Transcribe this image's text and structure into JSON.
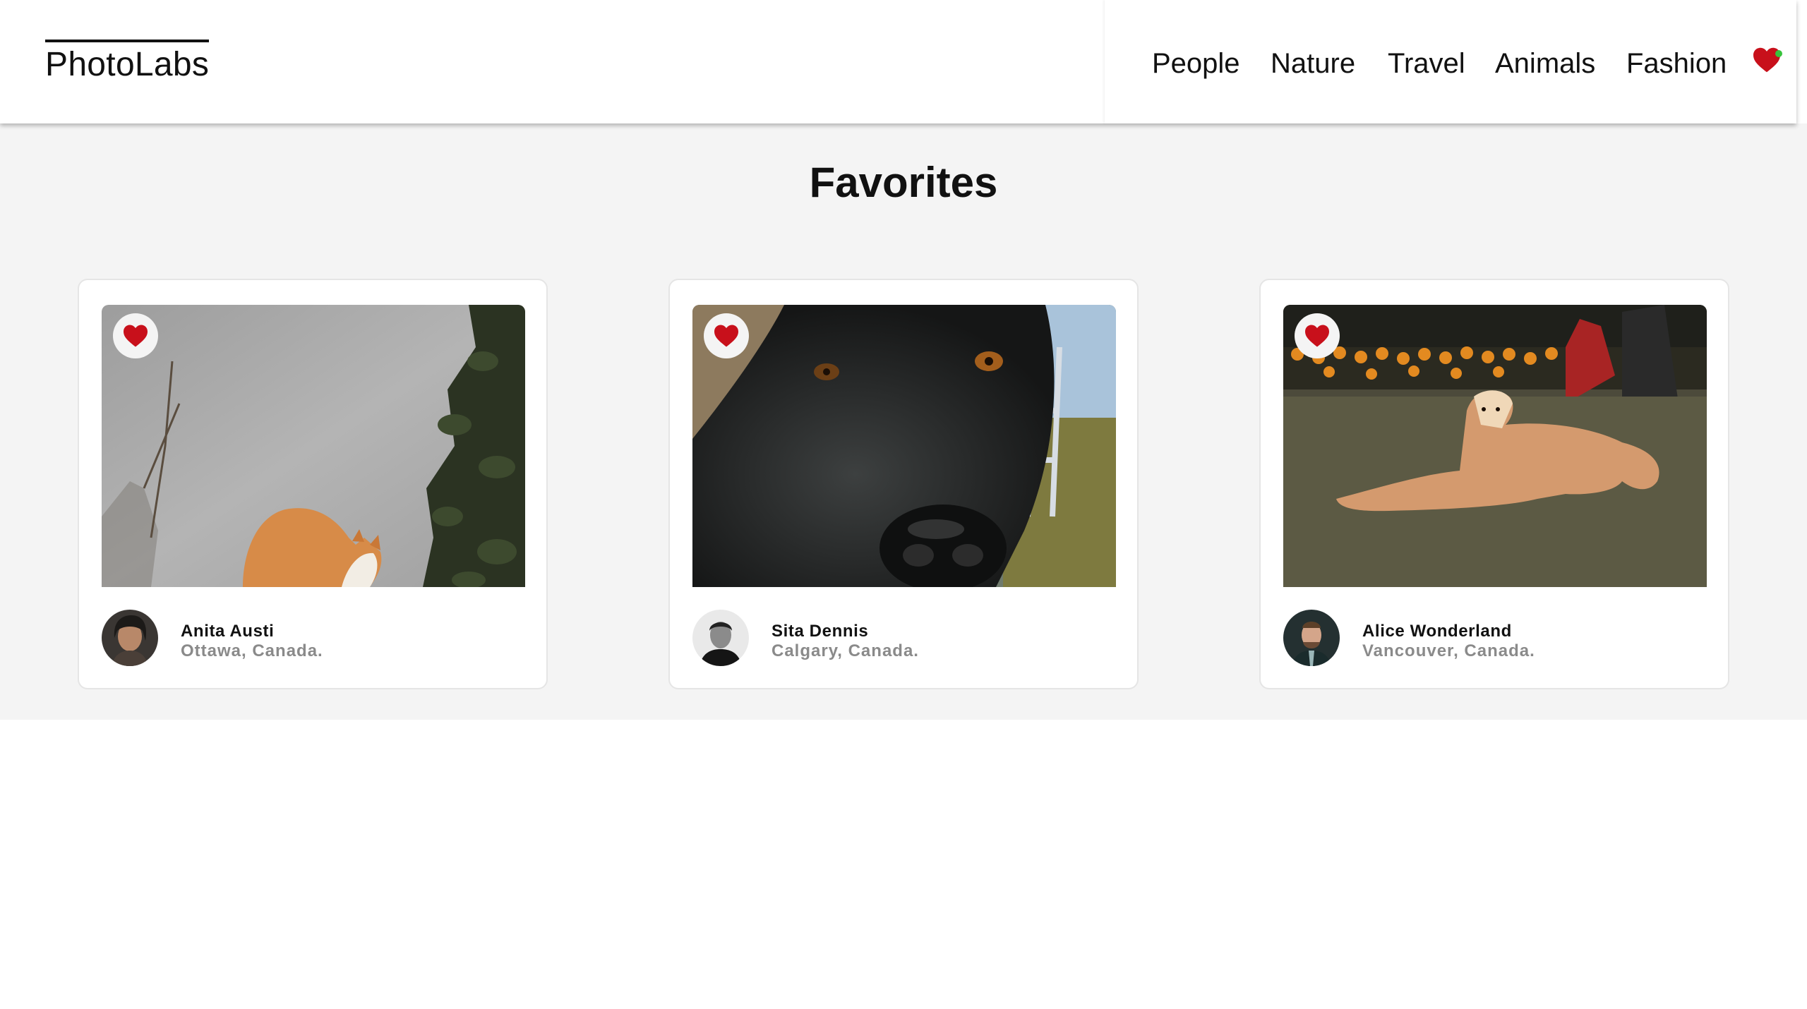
{
  "header": {
    "logo": "PhotoLabs",
    "topics": [
      {
        "label": "People"
      },
      {
        "label": "Nature"
      },
      {
        "label": "Travel"
      },
      {
        "label": "Animals"
      },
      {
        "label": "Fashion"
      }
    ],
    "favorites_icon": "heart-icon",
    "has_favorites_indicator": true
  },
  "page": {
    "title": "Favorites"
  },
  "photos": [
    {
      "user_name": "Anita Austi",
      "location": "Ottawa, Canada.",
      "favorited": true,
      "subject": "orange and white cat beside a grey wall with ivy"
    },
    {
      "user_name": "Sita Dennis",
      "location": "Calgary, Canada.",
      "favorited": true,
      "subject": "close-up of a black dog's nose"
    },
    {
      "user_name": "Alice Wonderland",
      "location": "Vancouver, Canada.",
      "favorited": true,
      "subject": "tan dog lying on grass near orange flowers"
    }
  ],
  "colors": {
    "heart": "#c8101b",
    "page_background": "#f4f4f4",
    "card_background": "#ffffff",
    "location_text": "#8a8a8a",
    "notification_dot": "#37c33c"
  }
}
